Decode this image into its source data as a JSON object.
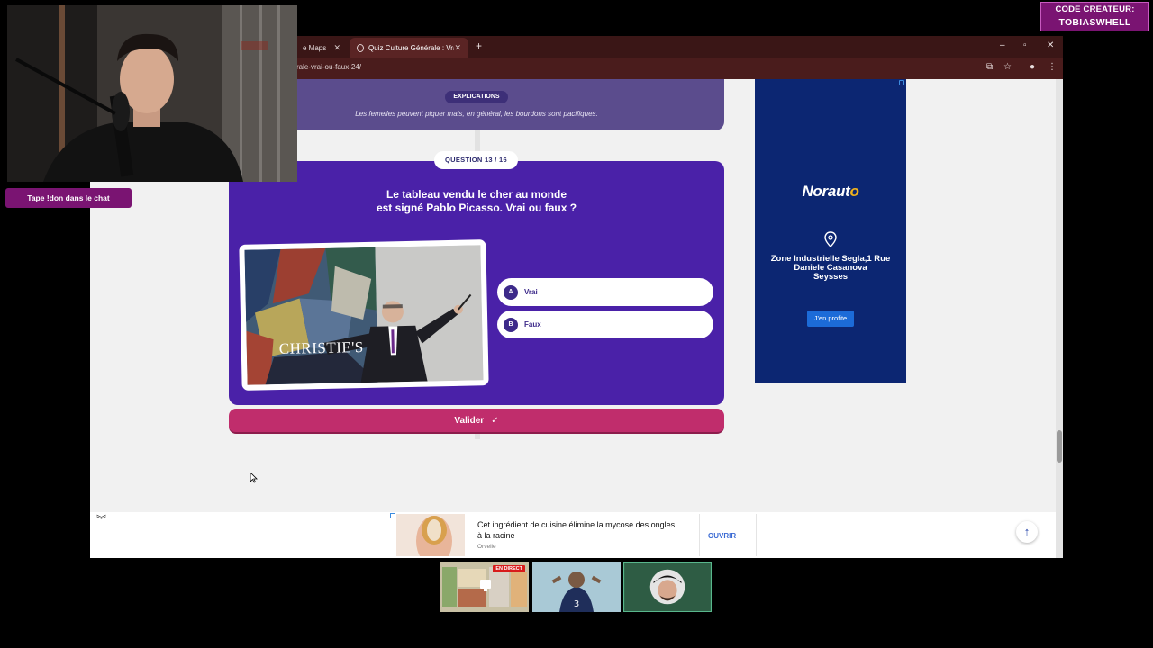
{
  "browser": {
    "tabs": [
      {
        "label": "e Maps",
        "state": "inactive"
      },
      {
        "label": "Quiz Culture Générale : Vrai ou",
        "state": "active"
      }
    ],
    "url": "rale-vrai-ou-faux-24/"
  },
  "quiz": {
    "explain_label": "EXPLICATIONS",
    "explain_text": "Les femelles peuvent piquer mais, en général, les bourdons sont pacifiques.",
    "question_badge": "QUESTION 13 / 16",
    "question_line1": "Le tableau vendu le cher au monde",
    "question_line2": "est signé Pablo Picasso. Vrai ou faux ?",
    "image_caption": "CHRISTIE'S",
    "answers": [
      {
        "letter": "A",
        "label": "Vrai"
      },
      {
        "letter": "B",
        "label": "Faux"
      }
    ],
    "submit_label": "Valider",
    "submit_icon": "check-icon"
  },
  "side_ad": {
    "brand_main": "Norauto",
    "address_line1": "Zone Industrielle Segla,1 Rue",
    "address_line2": "Daniele Casanova",
    "address_line3": "Seysses",
    "cta": "J'en profite",
    "colors": {
      "background": "#0c2672",
      "accent": "#f0b21d",
      "button": "#1c6bd8"
    }
  },
  "bottom_ad": {
    "title_line1": "Cet ingrédient de cuisine élimine la mycose des ongles",
    "title_line2": "à la racine",
    "source": "Orvelle",
    "cta": "OUVRIR"
  },
  "overlay": {
    "chat_prompt": "Tape !don dans le chat",
    "creator_line1": "CODE CREATEUR:",
    "creator_line2": "TOBIASWHELL",
    "live_badge": "EN DIRECT",
    "jersey_number": "3"
  },
  "colors": {
    "card": "#4a21a8",
    "submit": "#c02d6c",
    "tabbar": "#3a1616",
    "overlay": "#7a1472"
  }
}
